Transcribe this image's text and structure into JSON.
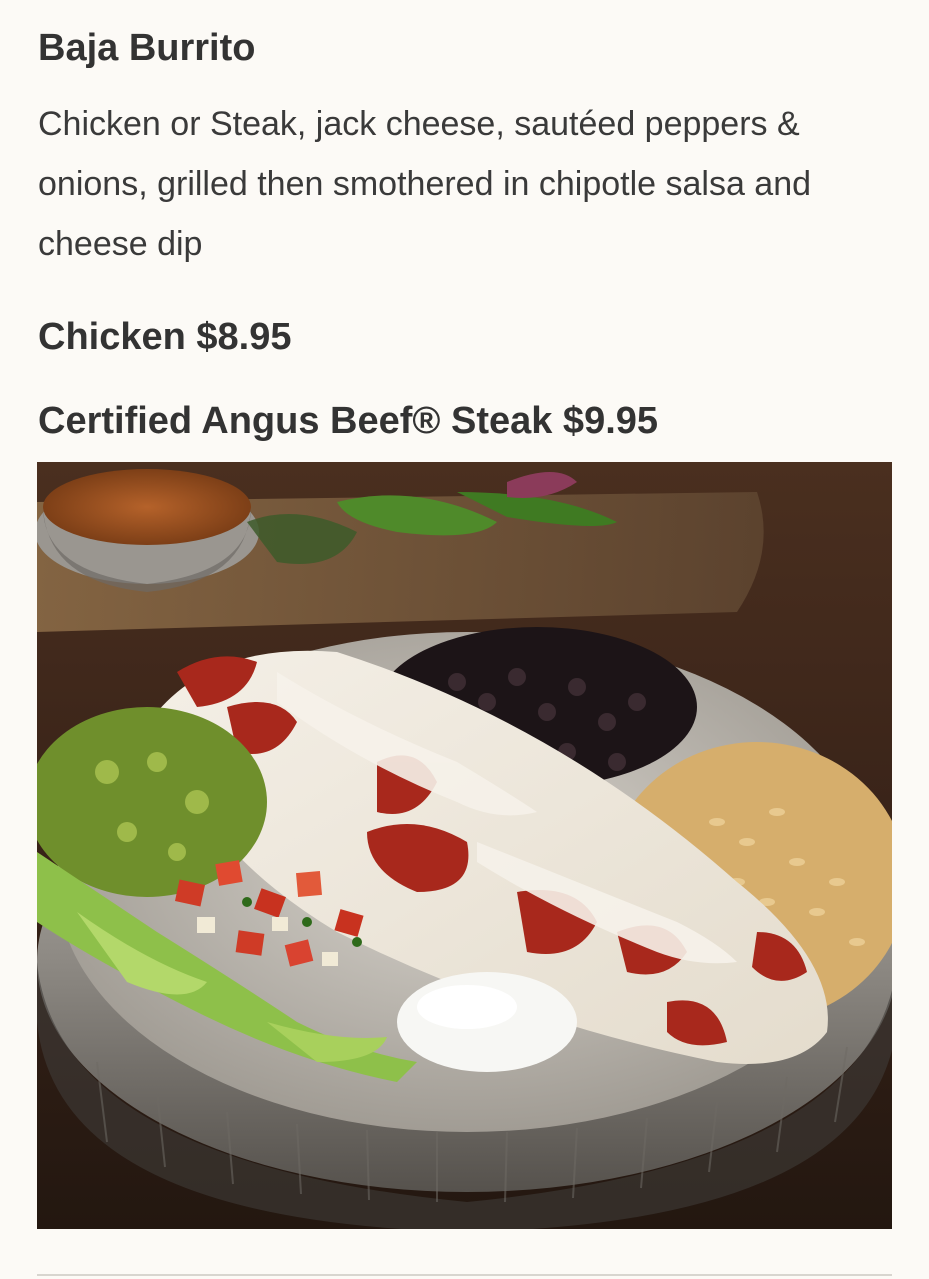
{
  "menu_item": {
    "title": "Baja Burrito",
    "description": "Chicken or Steak, jack cheese, sautéed peppers & onions, grilled then smothered in chipotle salsa and cheese dip",
    "prices": [
      {
        "label": "Chicken $8.95"
      },
      {
        "label": "Certified Angus Beef® Steak $9.95"
      }
    ]
  },
  "colors": {
    "page_background": "#fcfaf6",
    "text": "#333333",
    "divider": "#d8d5cf"
  }
}
